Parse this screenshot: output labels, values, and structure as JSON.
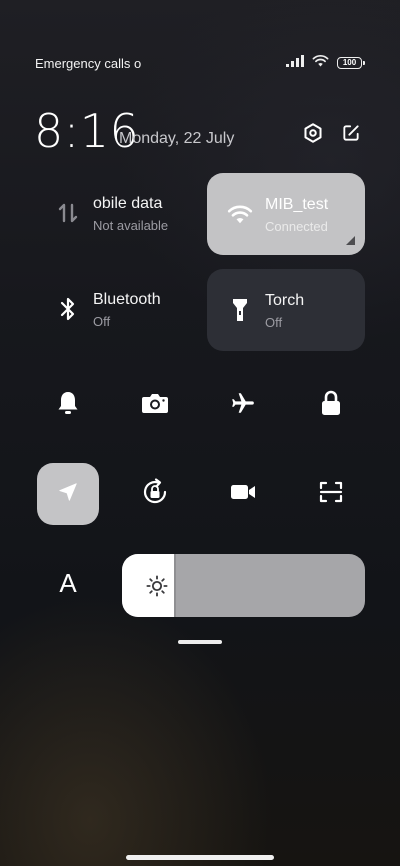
{
  "status_bar": {
    "carrier_text": "Emergency calls o",
    "signal_icon": "signal-icon",
    "wifi_icon": "wifi-icon",
    "battery_level": "100"
  },
  "header": {
    "time": "8:16",
    "date": "Monday, 22 July",
    "settings_icon": "settings-icon",
    "edit_icon": "edit-icon"
  },
  "tiles": [
    {
      "title": "obile data",
      "subtitle": "Not available",
      "icon": "mobile-data-icon",
      "active": false
    },
    {
      "title": "MIB_test",
      "subtitle": "Connected",
      "icon": "wifi-icon",
      "active": true
    },
    {
      "title": "Bluetooth",
      "subtitle": "Off",
      "icon": "bluetooth-icon",
      "active": false
    },
    {
      "title": "Torch",
      "subtitle": "Off",
      "icon": "torch-icon",
      "active": false
    }
  ],
  "toggle_row_1": [
    {
      "icon": "bell-icon",
      "active": false
    },
    {
      "icon": "camera-icon",
      "active": false
    },
    {
      "icon": "airplane-icon",
      "active": false
    },
    {
      "icon": "lock-icon",
      "active": false
    }
  ],
  "toggle_row_2": [
    {
      "icon": "location-icon",
      "active": true
    },
    {
      "icon": "rotation-lock-icon",
      "active": false
    },
    {
      "icon": "video-icon",
      "active": false
    },
    {
      "icon": "scan-icon",
      "active": false
    }
  ],
  "text_size_label": "A",
  "brightness": {
    "level": 0.22,
    "icon": "sun-icon"
  },
  "colors": {
    "active_tile": "#c3c3c5",
    "torch_tile": "#2d2f36",
    "slider_track": "#a6a6a9"
  }
}
